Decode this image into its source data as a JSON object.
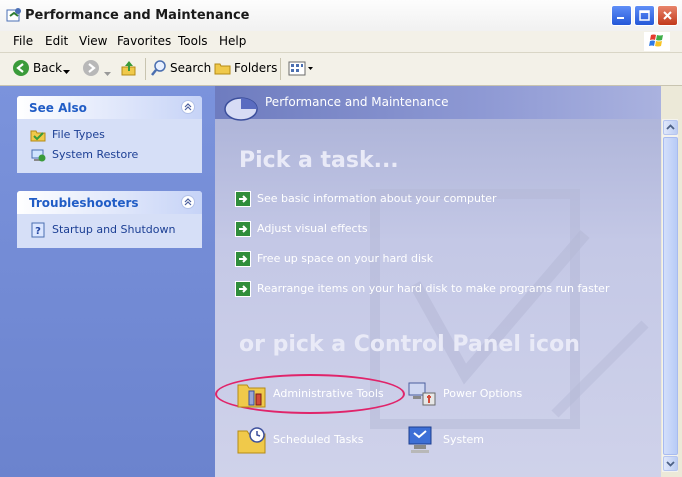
{
  "window": {
    "title": "Performance and Maintenance"
  },
  "menu": [
    "File",
    "Edit",
    "View",
    "Favorites",
    "Tools",
    "Help"
  ],
  "toolbar": {
    "back_label": "Back",
    "search_label": "Search",
    "folders_label": "Folders"
  },
  "see_also": {
    "title": "See Also",
    "items": [
      "File Types",
      "System Restore"
    ]
  },
  "troubleshooters": {
    "title": "Troubleshooters",
    "items": [
      "Startup and Shutdown"
    ]
  },
  "main": {
    "header": "Performance and Maintenance",
    "pick_task": "Pick a task...",
    "tasks": [
      "See basic information about your computer",
      "Adjust visual effects",
      "Free up space on your hard disk",
      "Rearrange items on your hard disk to make programs run faster"
    ],
    "pick_icon": "or pick a Control Panel icon",
    "icons": [
      "Administrative Tools",
      "Power Options",
      "Scheduled Tasks",
      "System"
    ]
  },
  "colors": {
    "left_pane": "#7b93dc",
    "right_pane": "#c4c8e6",
    "highlight": "#e0246a",
    "link_text": "#1c3f94"
  }
}
